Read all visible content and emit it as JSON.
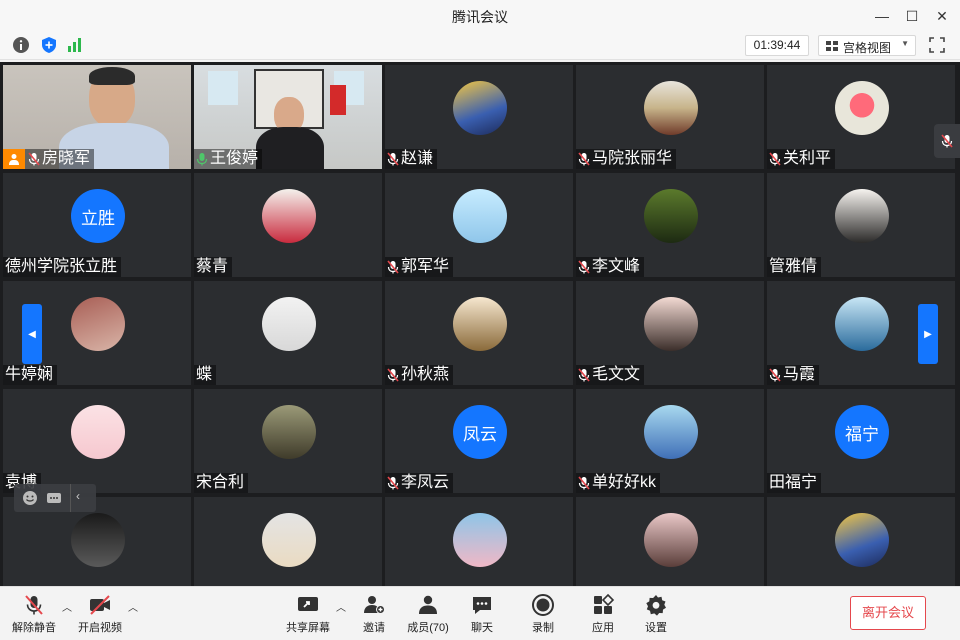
{
  "window": {
    "title": "腾讯会议"
  },
  "toolbar": {
    "timer": "01:39:44",
    "view_label": "宫格视图"
  },
  "participants": [
    {
      "name": "房晓军",
      "type": "video",
      "host": true,
      "muted": true
    },
    {
      "name": "王俊婷",
      "type": "video",
      "host": false,
      "muted": false,
      "speaking": true
    },
    {
      "name": "赵谦",
      "type": "avatar",
      "muted": true
    },
    {
      "name": "马院张丽华",
      "type": "avatar",
      "muted": true
    },
    {
      "name": "关利平",
      "type": "avatar",
      "muted": true
    },
    {
      "name": "德州学院张立胜",
      "type": "text",
      "avatar_text": "立胜",
      "muted": false
    },
    {
      "name": "蔡青",
      "type": "avatar",
      "muted": false
    },
    {
      "name": "郭军华",
      "type": "avatar",
      "muted": true
    },
    {
      "name": "李文峰",
      "type": "avatar",
      "muted": true
    },
    {
      "name": "管雅倩",
      "type": "avatar",
      "muted": false
    },
    {
      "name": "牛婷娴",
      "type": "avatar",
      "muted": false
    },
    {
      "name": "蝶",
      "type": "avatar",
      "muted": false
    },
    {
      "name": "孙秋燕",
      "type": "avatar",
      "muted": true
    },
    {
      "name": "毛文文",
      "type": "avatar",
      "muted": true
    },
    {
      "name": "马霞",
      "type": "avatar",
      "muted": true
    },
    {
      "name": "袁博",
      "type": "avatar",
      "muted": false
    },
    {
      "name": "宋合利",
      "type": "avatar",
      "muted": false
    },
    {
      "name": "李凤云",
      "type": "text",
      "avatar_text": "凤云",
      "muted": true
    },
    {
      "name": "单好好kk",
      "type": "avatar",
      "muted": true
    },
    {
      "name": "田福宁",
      "type": "text",
      "avatar_text": "福宁",
      "muted": false
    },
    {
      "name": "",
      "type": "avatar",
      "muted": false
    },
    {
      "name": "",
      "type": "avatar",
      "muted": false
    },
    {
      "name": "",
      "type": "avatar",
      "muted": false
    },
    {
      "name": "",
      "type": "avatar",
      "muted": false
    },
    {
      "name": "",
      "type": "avatar",
      "muted": false
    }
  ],
  "bottombar": {
    "unmute": "解除静音",
    "start_video": "开启视频",
    "share_screen": "共享屏幕",
    "invite": "邀请",
    "members": "成员(70)",
    "chat": "聊天",
    "record": "录制",
    "apps": "应用",
    "settings": "设置",
    "leave": "离开会议"
  },
  "colors": {
    "accent": "#1476ff",
    "leave": "#e5484d",
    "host": "#ff8a00",
    "speaking": "#4ec76a"
  }
}
